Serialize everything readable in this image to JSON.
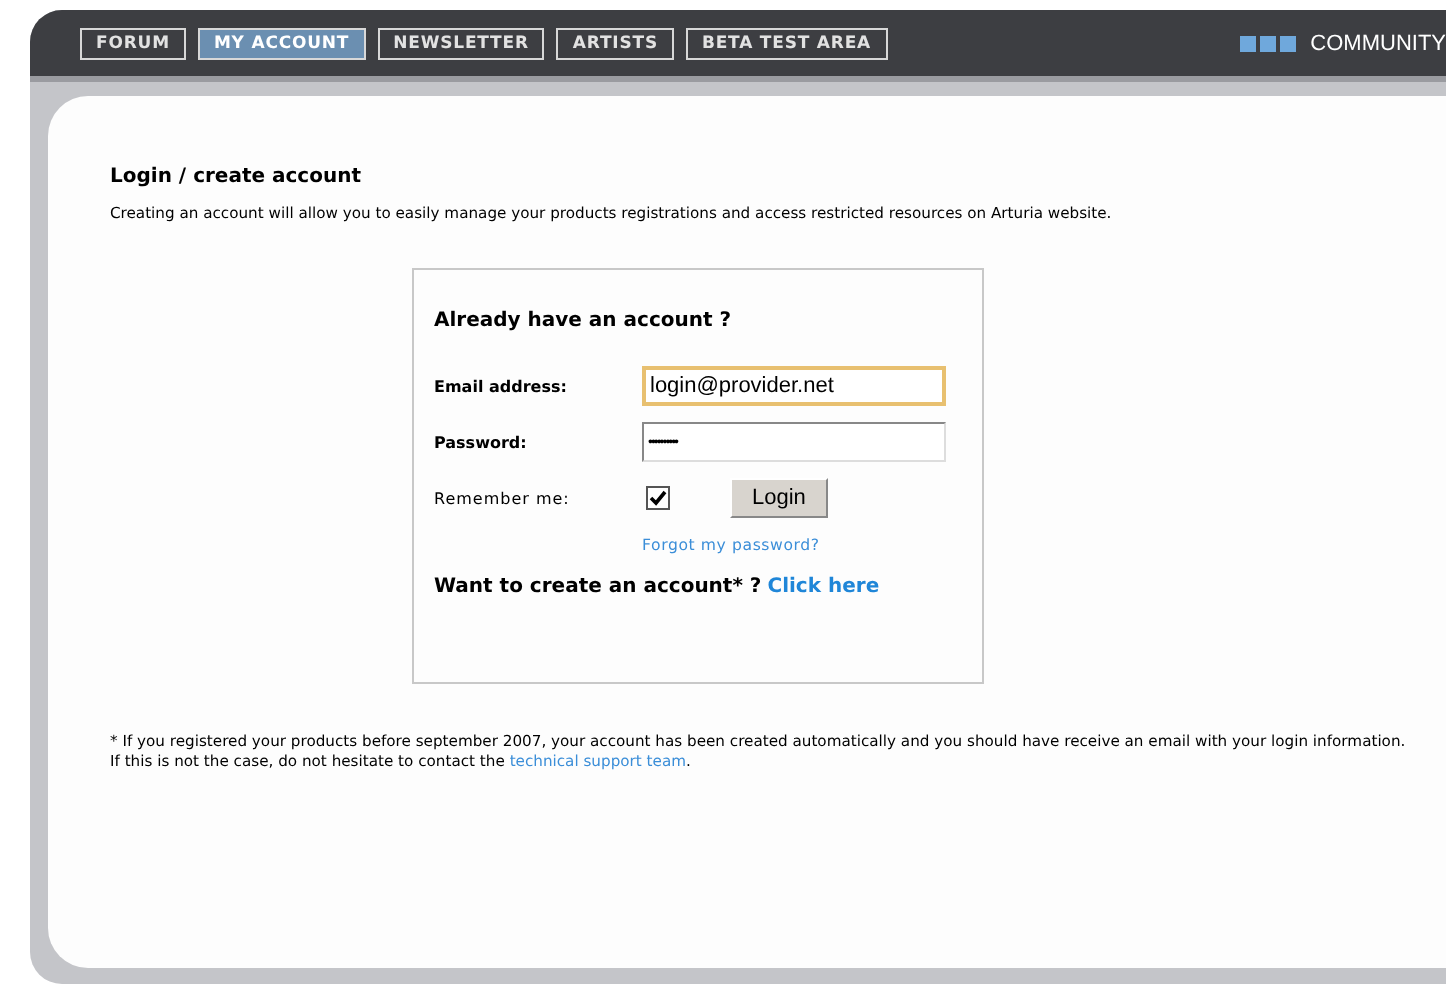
{
  "nav": {
    "tabs": [
      {
        "label": "FORUM",
        "selected": false
      },
      {
        "label": "MY ACCOUNT",
        "selected": true
      },
      {
        "label": "NEWSLETTER",
        "selected": false
      },
      {
        "label": "ARTISTS",
        "selected": false
      },
      {
        "label": "BETA TEST AREA",
        "selected": false
      }
    ],
    "section": "COMMUNITY"
  },
  "title": "Login / create account",
  "intro": "Creating an account will allow you to easily manage your products registrations and access restricted resources on Arturia website.",
  "login": {
    "heading": "Already have an account ?",
    "email": {
      "label": "Email address:",
      "value": "login@provider.net",
      "focused": true
    },
    "password": {
      "label": "Password:",
      "value": "••••••••••"
    },
    "remember": {
      "label": "Remember me:",
      "checked": true
    },
    "button": "Login",
    "forgot": "Forgot my password?",
    "create": {
      "text": "Want to create an account* ?",
      "link": "Click here"
    }
  },
  "footnote": {
    "text": "* If you registered your products before september 2007, your account has been created automatically and you should have receive an email with your login information. If this is not the case, do not hesitate to contact the",
    "link": "technical support team",
    "end": "."
  }
}
